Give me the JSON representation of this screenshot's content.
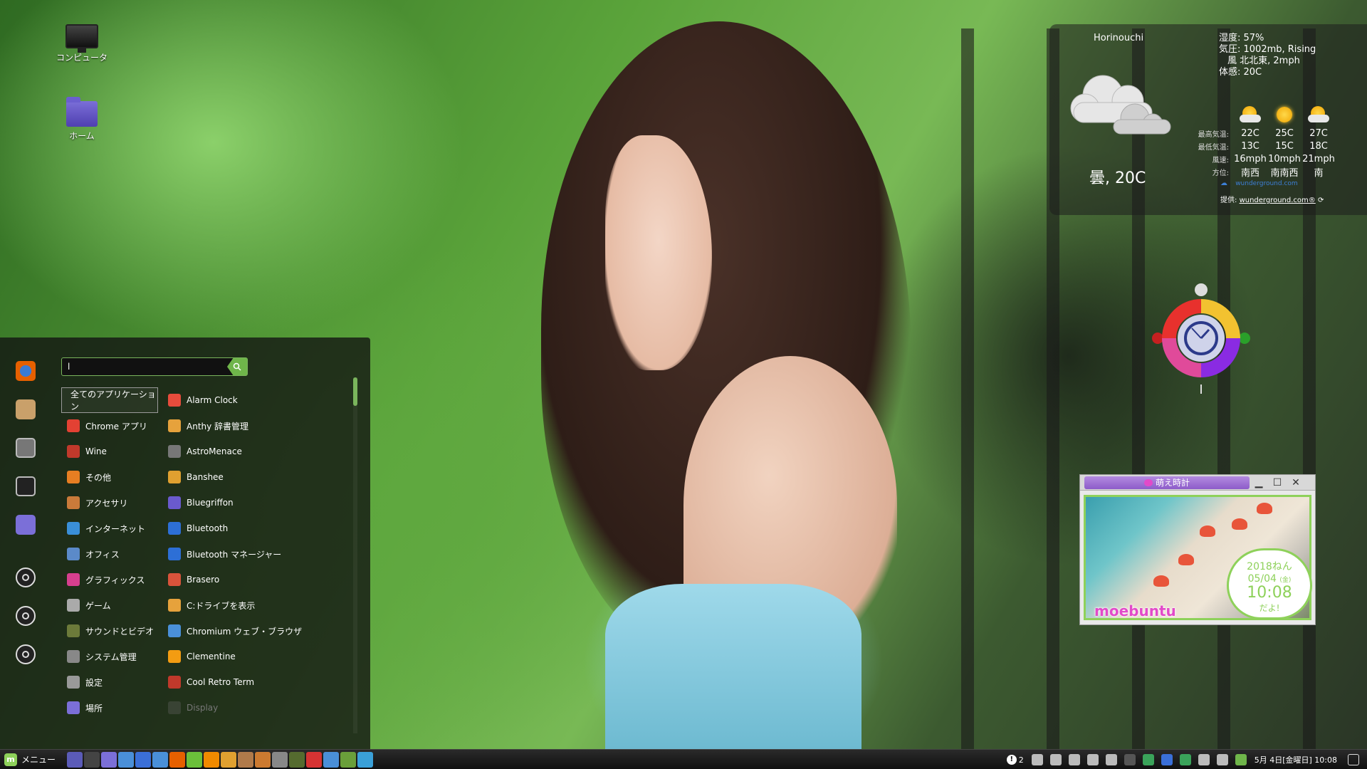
{
  "desktop": {
    "icons": [
      {
        "label": "コンピュータ"
      },
      {
        "label": "ホーム"
      }
    ]
  },
  "weather": {
    "location": "Horinouchi",
    "details": [
      "湿度: 57%",
      "気圧: 1002mb, Rising",
      "風 北北東, 2mph",
      "体感: 20C"
    ],
    "current": "曇, 20C",
    "forecast_labels": {
      "high": "最高気温:",
      "low": "最低気温:",
      "wind": "風速:",
      "direction": "方位:"
    },
    "forecast": [
      {
        "icon": "partly-sunny-icon",
        "high": "22C",
        "low": "13C",
        "wind": "16mph",
        "direction": "南西"
      },
      {
        "icon": "sunny-icon",
        "high": "25C",
        "low": "15C",
        "wind": "10mph",
        "direction": "南南西"
      },
      {
        "icon": "partly-sunny-icon",
        "high": "27C",
        "low": "18C",
        "wind": "21mph",
        "direction": "南"
      }
    ],
    "provider_logo": "wunderground.com",
    "credit_prefix": "提供:",
    "credit_link": "wunderground.com®"
  },
  "moe_clock": {
    "title": "萌え時計",
    "year": "2018ねん",
    "date": "05/04",
    "weekday": "(金)",
    "time": "10:08",
    "suffix": "だよ!",
    "brand": "moebuntu"
  },
  "menu": {
    "search_value": "l",
    "categories": [
      {
        "label": "全てのアプリケーション",
        "icon": "all-apps-icon",
        "color": ""
      },
      {
        "label": "Chrome アプリ",
        "icon": "chrome-icon",
        "color": "#e34133"
      },
      {
        "label": "Wine",
        "icon": "wine-icon",
        "color": "#c0392b"
      },
      {
        "label": "その他",
        "icon": "other-icon",
        "color": "#e67e22"
      },
      {
        "label": "アクセサリ",
        "icon": "accessories-icon",
        "color": "#c97a3a"
      },
      {
        "label": "インターネット",
        "icon": "internet-icon",
        "color": "#3a8fd8"
      },
      {
        "label": "オフィス",
        "icon": "office-icon",
        "color": "#5b8ac9"
      },
      {
        "label": "グラフィックス",
        "icon": "graphics-icon",
        "color": "#d63f8e"
      },
      {
        "label": "ゲーム",
        "icon": "games-icon",
        "color": "#aaaaaa"
      },
      {
        "label": "サウンドとビデオ",
        "icon": "sound-video-icon",
        "color": "#6c7a3a"
      },
      {
        "label": "システム管理",
        "icon": "system-admin-icon",
        "color": "#888888"
      },
      {
        "label": "設定",
        "icon": "settings-icon",
        "color": "#999999"
      },
      {
        "label": "場所",
        "icon": "places-icon",
        "color": "#7b6fd8"
      }
    ],
    "apps": [
      {
        "label": "Alarm Clock",
        "icon": "alarm-clock-icon",
        "color": "#e74c3c"
      },
      {
        "label": "Anthy 辞書管理",
        "icon": "anthy-icon",
        "color": "#e6a23c"
      },
      {
        "label": "AstroMenace",
        "icon": "astromenace-icon",
        "color": "#777777"
      },
      {
        "label": "Banshee",
        "icon": "banshee-icon",
        "color": "#e0a030"
      },
      {
        "label": "Bluegriffon",
        "icon": "bluegriffon-icon",
        "color": "#6a5acd"
      },
      {
        "label": "Bluetooth",
        "icon": "bluetooth-icon",
        "color": "#2d6fd6"
      },
      {
        "label": "Bluetooth マネージャー",
        "icon": "bluetooth-manager-icon",
        "color": "#2d6fd6"
      },
      {
        "label": "Brasero",
        "icon": "brasero-icon",
        "color": "#d9533b"
      },
      {
        "label": "C:ドライブを表示",
        "icon": "c-drive-icon",
        "color": "#e6a23c"
      },
      {
        "label": "Chromium ウェブ・ブラウザ",
        "icon": "chromium-icon",
        "color": "#4a90d9"
      },
      {
        "label": "Clementine",
        "icon": "clementine-icon",
        "color": "#f39c12"
      },
      {
        "label": "Cool Retro Term",
        "icon": "cool-retro-term-icon",
        "color": "#c0392b"
      },
      {
        "label": "Display",
        "icon": "display-icon",
        "color": "#666666"
      }
    ],
    "favorites": [
      {
        "icon": "firefox-icon",
        "color": "#e66000"
      },
      {
        "icon": "package-installer-icon",
        "color": "#c9a06a"
      },
      {
        "icon": "system-settings-icon",
        "color": "#777777"
      },
      {
        "icon": "terminal-icon",
        "color": "#333333"
      },
      {
        "icon": "files-folder-icon",
        "color": "#7b6fd8"
      }
    ],
    "system_buttons": [
      {
        "icon": "lock-screen-icon"
      },
      {
        "icon": "logout-icon"
      },
      {
        "icon": "shutdown-icon"
      }
    ]
  },
  "panel": {
    "menu_label": "メニュー",
    "launchers": [
      {
        "icon": "show-desktop-icon",
        "color": "#5b5bb8"
      },
      {
        "icon": "terminal-launcher-icon",
        "color": "#444444"
      },
      {
        "icon": "files-launcher-icon",
        "color": "#7b6fd8"
      },
      {
        "icon": "software-manager-icon",
        "color": "#4a8fd8"
      },
      {
        "icon": "bluetooth-launcher-icon",
        "color": "#3b6fd8"
      },
      {
        "icon": "chromium-launcher-icon",
        "color": "#4a90d9"
      },
      {
        "icon": "firefox-launcher-icon",
        "color": "#e66000"
      },
      {
        "icon": "spotify-launcher-icon",
        "color": "#6bbf3a"
      },
      {
        "icon": "vlc-launcher-icon",
        "color": "#f08a00"
      },
      {
        "icon": "banshee-launcher-icon",
        "color": "#e0a030"
      },
      {
        "icon": "mail-launcher-icon",
        "color": "#b07a4a"
      },
      {
        "icon": "disk-launcher-icon",
        "color": "#cc7a30"
      },
      {
        "icon": "calculator-launcher-icon",
        "color": "#888888"
      },
      {
        "icon": "system-monitor-launcher-icon",
        "color": "#556b2f"
      },
      {
        "icon": "record-launcher-icon",
        "color": "#d63333"
      },
      {
        "icon": "bluegriffon-launcher-icon",
        "color": "#4a8fd8"
      },
      {
        "icon": "scanner-launcher-icon",
        "color": "#6a9f3a"
      },
      {
        "icon": "writer-launcher-icon",
        "color": "#3aa0d8"
      }
    ],
    "notification_count": "2",
    "clock": "5月 4日[金曜日] 10:08"
  }
}
